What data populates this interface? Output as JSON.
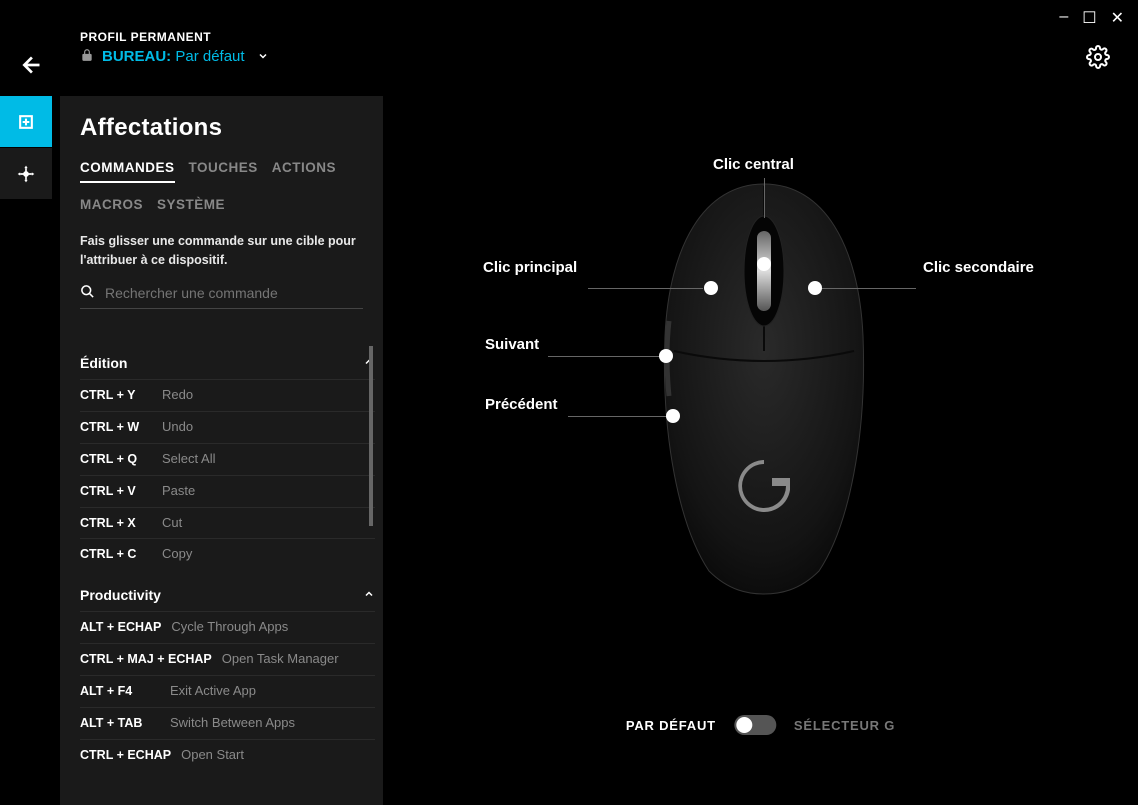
{
  "window": {
    "min": "–",
    "max": "☐",
    "close": "✕"
  },
  "header": {
    "profile_label": "PROFIL PERMANENT",
    "bureau": "BUREAU:",
    "default": "Par défaut"
  },
  "panel": {
    "title": "Affectations",
    "tabs": [
      "COMMANDES",
      "TOUCHES",
      "ACTIONS",
      "MACROS",
      "SYSTÈME"
    ],
    "active_tab": 0,
    "hint": "Fais glisser une commande sur une cible pour l'attribuer à ce dispositif.",
    "search_placeholder": "Rechercher une commande"
  },
  "sections": [
    {
      "name": "Édition",
      "items": [
        {
          "keys": "CTRL + Y",
          "label": "Redo"
        },
        {
          "keys": "CTRL + W",
          "label": "Undo"
        },
        {
          "keys": "CTRL + Q",
          "label": "Select All"
        },
        {
          "keys": "CTRL + V",
          "label": "Paste"
        },
        {
          "keys": "CTRL + X",
          "label": "Cut"
        },
        {
          "keys": "CTRL + C",
          "label": "Copy"
        }
      ]
    },
    {
      "name": "Productivity",
      "items": [
        {
          "keys": "ALT + ECHAP",
          "label": "Cycle Through Apps"
        },
        {
          "keys": "CTRL + MAJ + ECHAP",
          "label": "Open Task Manager"
        },
        {
          "keys": "ALT + F4",
          "label": "Exit Active App"
        },
        {
          "keys": "ALT + TAB",
          "label": "Switch Between Apps"
        },
        {
          "keys": "CTRL + ECHAP",
          "label": "Open Start"
        }
      ]
    }
  ],
  "mouse_labels": {
    "center": "Clic central",
    "primary": "Clic principal",
    "secondary": "Clic secondaire",
    "forward": "Suivant",
    "back": "Précédent"
  },
  "mode": {
    "on": "PAR DÉFAUT",
    "off": "SÉLECTEUR G"
  }
}
